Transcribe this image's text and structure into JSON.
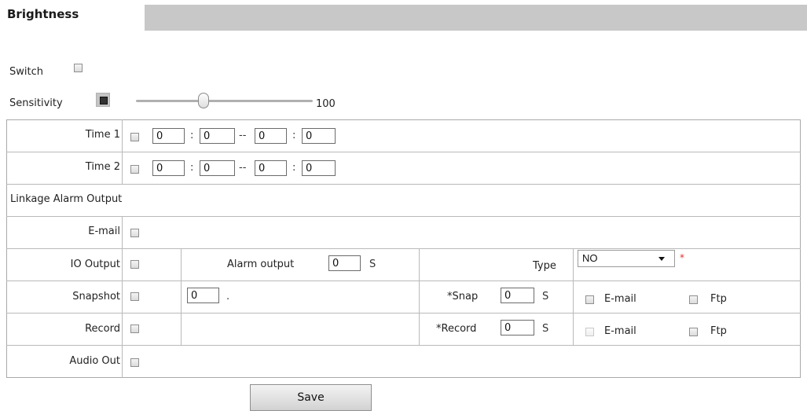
{
  "header": {
    "title": "Brightness"
  },
  "switch": {
    "label": "Switch"
  },
  "sensitivity": {
    "label": "Sensitivity",
    "value": "100",
    "level": 0.38
  },
  "time1": {
    "label": "Time 1",
    "h1": "0",
    "m1": "0",
    "h2": "0",
    "m2": "0"
  },
  "time2": {
    "label": "Time 2",
    "h1": "0",
    "m1": "0",
    "h2": "0",
    "m2": "0"
  },
  "separators": {
    "colon": ":",
    "dash": "--"
  },
  "linkage": {
    "title": "Linkage Alarm Output"
  },
  "email_row": {
    "label": "E-mail"
  },
  "io": {
    "label": "IO Output",
    "alarm_label": "Alarm output",
    "alarm_value": "0",
    "alarm_unit": "S",
    "type_label": "Type",
    "type_value": "NO",
    "required_mark": "*"
  },
  "snapshot": {
    "label": "Snapshot",
    "count_value": "0",
    "dot": ".",
    "snap_label": "*Snap",
    "snap_value": "0",
    "snap_unit": "S",
    "email_label": "E-mail",
    "ftp_label": "Ftp"
  },
  "record": {
    "label": "Record",
    "record_label": "*Record",
    "record_value": "0",
    "record_unit": "S",
    "email_label": "E-mail",
    "ftp_label": "Ftp"
  },
  "audio": {
    "label": "Audio Out"
  },
  "save": {
    "label": "Save"
  }
}
